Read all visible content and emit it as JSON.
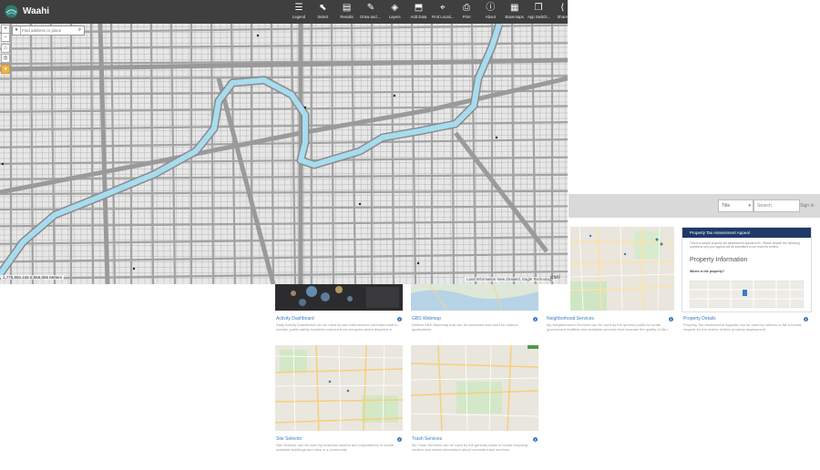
{
  "app": {
    "name": "Waahi",
    "toolbar": [
      {
        "label": "Legend",
        "icon": "legend-icon",
        "glyph": "☰"
      },
      {
        "label": "Select",
        "icon": "select-cursor-icon",
        "glyph": "⬉"
      },
      {
        "label": "Results",
        "icon": "results-icon",
        "glyph": "▤"
      },
      {
        "label": "Draw and ...",
        "icon": "draw-icon",
        "glyph": "✎"
      },
      {
        "label": "Layers",
        "icon": "layers-icon",
        "glyph": "◈"
      },
      {
        "label": "Add Data",
        "icon": "add-data-icon",
        "glyph": "⬒"
      },
      {
        "label": "Find Locati...",
        "icon": "find-location-icon",
        "glyph": "⌖"
      },
      {
        "label": "Print",
        "icon": "print-icon",
        "glyph": "⎙"
      },
      {
        "label": "About",
        "icon": "about-icon",
        "glyph": "ⓘ"
      },
      {
        "label": "Basemaps",
        "icon": "basemaps-icon",
        "glyph": "▦"
      },
      {
        "label": "App Switch...",
        "icon": "app-switcher-icon",
        "glyph": "❐"
      },
      {
        "label": "Share",
        "icon": "share-icon",
        "glyph": "⟨"
      }
    ],
    "search": {
      "placeholder": "Find address or place"
    },
    "coordinates": "1,775,950.445 5,955,655 Meters",
    "attribution": "Land Information New Zealand, Eagle Technology",
    "esri": "esri"
  },
  "gallery": {
    "title_select": "Title",
    "search_placeholder": "Search",
    "sign_in": "Sign In",
    "cards": [
      {
        "title": "Activity Dashboard",
        "desc": "Daily Activity Dashboard can be used by law enforcement command staff to monitor public safety incidents sourced from computer-aided dispatch or records"
      },
      {
        "title": "GBS Webmap",
        "desc": "Default GBS Basemap that can be accessed and used for various applications"
      },
      {
        "title": "Neighborhood Services",
        "desc": "My Neighborhood Services can be used by the general public to locate government facilities and available services that increase the quality of life i"
      },
      {
        "title": "Property Details",
        "desc": "Property Tax Assessment Appeals can be used by citizens to file a formal request for the review of their property assessment"
      },
      {
        "title": "Site Selector",
        "desc": "Site Selector can be used by business owners and corporations to locate available buildings and sites in a community"
      },
      {
        "title": "Trash Services",
        "desc": "My Trash Services can be used by the general public to locate recycling centers and obtain information about curbside trash services"
      }
    ],
    "property_panel": {
      "header": "Property Tax Assessment Appeal",
      "intro": "This is a simple property tax assessment appeal form. Please answer the following questions and your appeal will be submitted to our team for review.",
      "section": "Property Information",
      "question": "Where is the property?"
    }
  },
  "colors": {
    "toolbar": "#3f3f3f",
    "river": "#a7dcef",
    "road": "#a3a3a3",
    "accent": "#3b7dc0",
    "panel_header": "#1f3a68"
  }
}
